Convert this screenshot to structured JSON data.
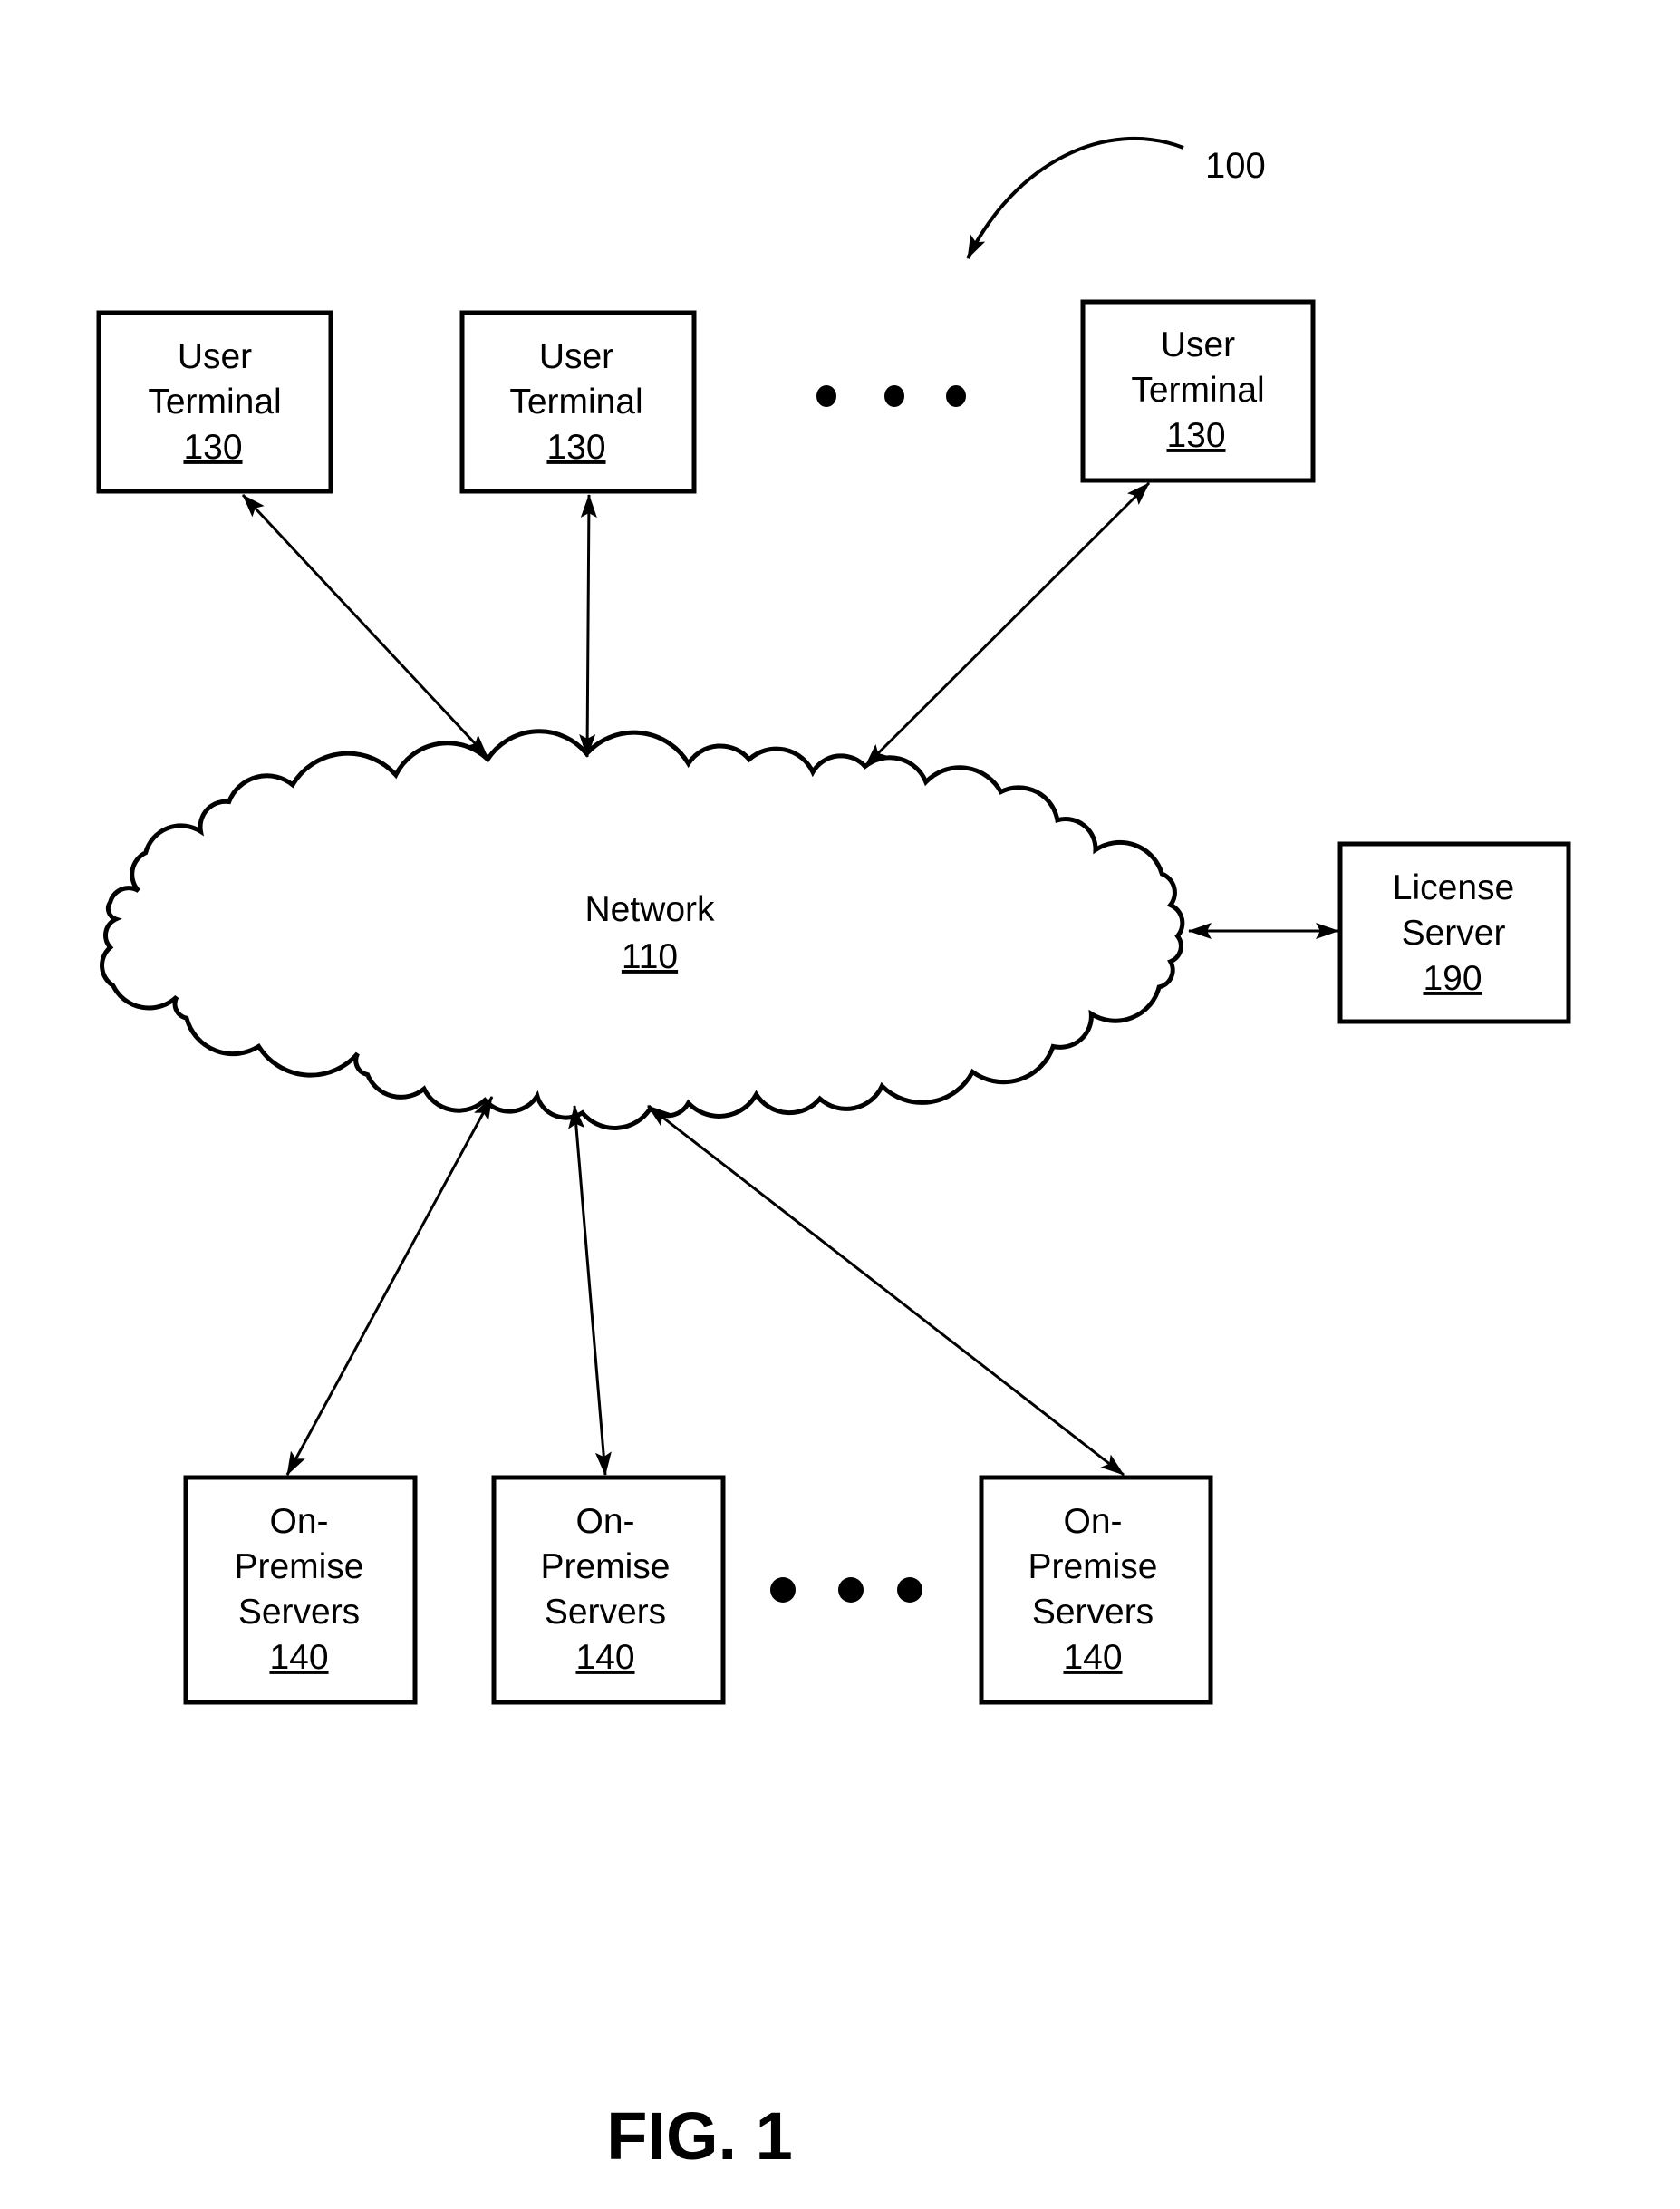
{
  "figure": {
    "label": "FIG. 1",
    "reference_numeral": "100"
  },
  "network": {
    "name": "Network",
    "ref": "110"
  },
  "user_terminals": [
    {
      "lines": [
        "User",
        "Terminal"
      ],
      "ref": "130"
    },
    {
      "lines": [
        "User",
        "Terminal"
      ],
      "ref": "130"
    },
    {
      "lines": [
        "User",
        "Terminal"
      ],
      "ref": "130"
    }
  ],
  "license_server": {
    "lines": [
      "License",
      "Server"
    ],
    "ref": "190"
  },
  "on_premise_servers": [
    {
      "lines": [
        "On-",
        "Premise",
        "Servers"
      ],
      "ref": "140"
    },
    {
      "lines": [
        "On-",
        "Premise",
        "Servers"
      ],
      "ref": "140"
    },
    {
      "lines": [
        "On-",
        "Premise",
        "Servers"
      ],
      "ref": "140"
    }
  ],
  "ellipsis_indicators": [
    {
      "between": "user-terminals",
      "dots": 3
    },
    {
      "between": "on-premise-servers",
      "dots": 3
    }
  ],
  "connections": [
    {
      "from": "user-terminal-1",
      "to": "network",
      "type": "bidirectional"
    },
    {
      "from": "user-terminal-2",
      "to": "network",
      "type": "bidirectional"
    },
    {
      "from": "user-terminal-3",
      "to": "network",
      "type": "bidirectional"
    },
    {
      "from": "network",
      "to": "license-server",
      "type": "bidirectional"
    },
    {
      "from": "network",
      "to": "on-premise-servers-1",
      "type": "bidirectional"
    },
    {
      "from": "network",
      "to": "on-premise-servers-2",
      "type": "bidirectional"
    },
    {
      "from": "network",
      "to": "on-premise-servers-3",
      "type": "bidirectional"
    }
  ]
}
